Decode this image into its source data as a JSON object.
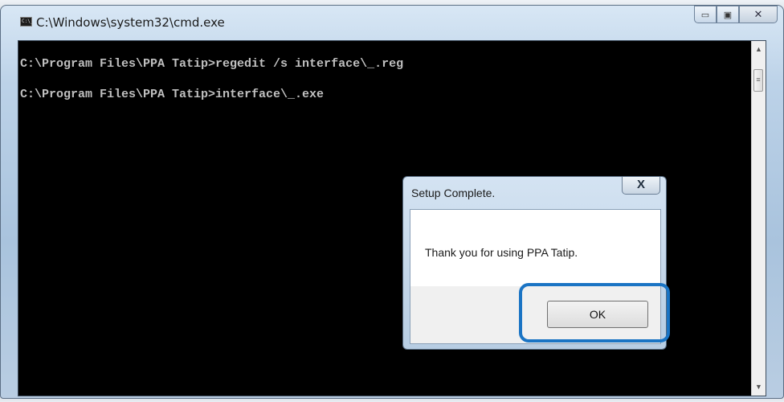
{
  "window": {
    "title": "C:\\Windows\\system32\\cmd.exe",
    "icon_text": "C:\\_",
    "caption_minimize": "▭",
    "caption_maximize": "▣",
    "caption_close": "✕"
  },
  "console": {
    "lines": [
      "C:\\Program Files\\PPA Tatip>regedit /s interface\\_.reg",
      "C:\\Program Files\\PPA Tatip>interface\\_.exe"
    ],
    "scroll_up": "▲",
    "scroll_down": "▼",
    "thumb_grip": "≡"
  },
  "dialog": {
    "title": "Setup Complete.",
    "close_label": "X",
    "message": "Thank you for using PPA Tatip.",
    "ok_label": "OK"
  },
  "colors": {
    "console_bg": "#000000",
    "console_text": "#c0c0c0",
    "highlight": "#1a74c4"
  }
}
